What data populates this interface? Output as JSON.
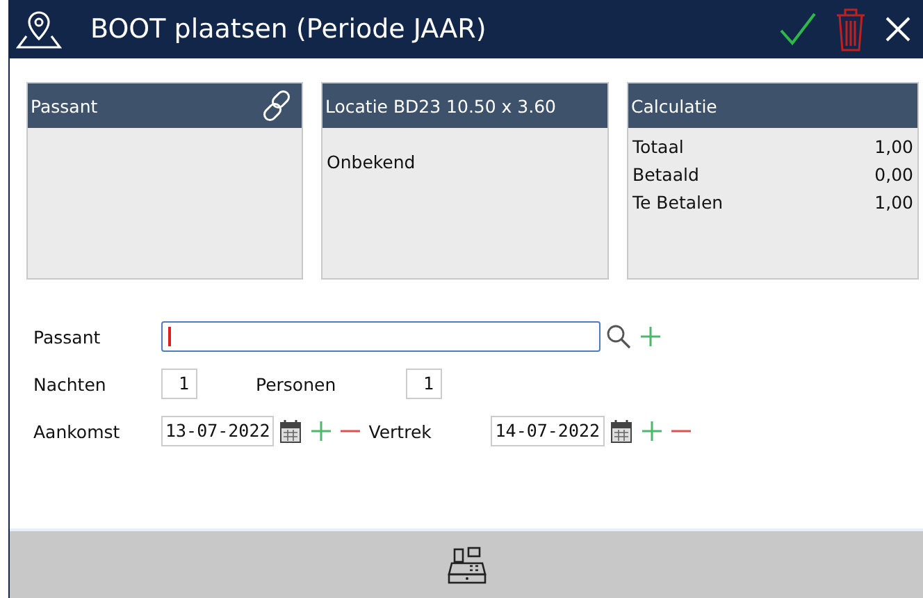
{
  "window": {
    "title": "BOOT plaatsen (Periode JAAR)"
  },
  "panels": [
    {
      "kind": "link",
      "title": "Passant"
    },
    {
      "kind": "text",
      "title": "Locatie BD23 10.50 x 3.60",
      "lines": [
        "Onbekend"
      ]
    },
    {
      "kind": "totals",
      "title": "Calculatie",
      "rows": [
        {
          "label": "Totaal",
          "value": "1,00"
        },
        {
          "label": "Betaald",
          "value": "0,00"
        },
        {
          "label": "Te Betalen",
          "value": "1,00"
        }
      ]
    }
  ],
  "form": {
    "passant_label": "Passant",
    "nachten_label": "Nachten",
    "nachten": "1",
    "personen_label": "Personen",
    "personen": "1",
    "aankomst_label": "Aankomst",
    "aankomst": "13-07-2022",
    "vertrek_label": "Vertrek",
    "vertrek": "14-07-2022"
  }
}
